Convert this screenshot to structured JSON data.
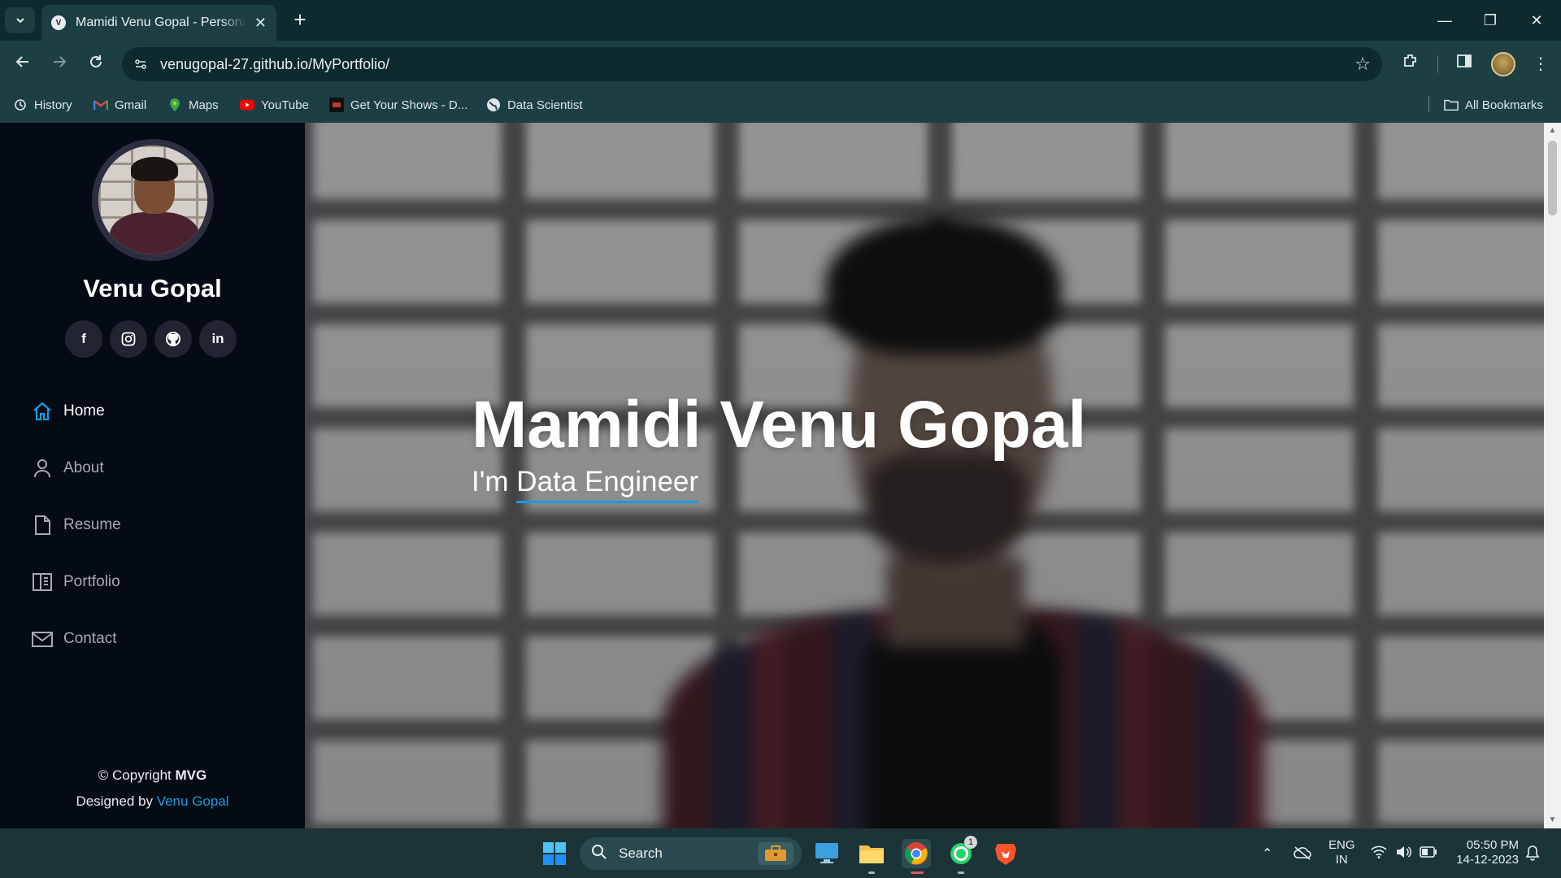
{
  "browser": {
    "tab_title": "Mamidi Venu Gopal - Personal",
    "tab_close": "✕",
    "new_tab": "+",
    "url": "venugopal-27.github.io/MyPortfolio/",
    "window_controls": {
      "minimize": "—",
      "restore": "❐",
      "close": "✕"
    }
  },
  "bookmarks": {
    "items": [
      {
        "label": "History",
        "icon": "history-icon"
      },
      {
        "label": "Gmail",
        "icon": "gmail-icon"
      },
      {
        "label": "Maps",
        "icon": "maps-icon"
      },
      {
        "label": "YouTube",
        "icon": "youtube-icon"
      },
      {
        "label": "Get Your Shows - D...",
        "icon": "shows-icon"
      },
      {
        "label": "Data Scientist",
        "icon": "globe-icon"
      }
    ],
    "all_bookmarks": "All Bookmarks"
  },
  "sidebar": {
    "name": "Venu Gopal",
    "social": [
      {
        "label": "f",
        "icon": "facebook-icon"
      },
      {
        "label": "◎",
        "icon": "instagram-icon"
      },
      {
        "label": "⌥",
        "icon": "github-icon"
      },
      {
        "label": "in",
        "icon": "linkedin-icon"
      }
    ],
    "nav": [
      {
        "label": "Home",
        "icon": "home-icon",
        "active": true
      },
      {
        "label": "About",
        "icon": "person-icon",
        "active": false
      },
      {
        "label": "Resume",
        "icon": "file-icon",
        "active": false
      },
      {
        "label": "Portfolio",
        "icon": "book-icon",
        "active": false
      },
      {
        "label": "Contact",
        "icon": "envelope-icon",
        "active": false
      }
    ],
    "footer": {
      "copyright_prefix": "© Copyright ",
      "copyright_name": "MVG",
      "designed_prefix": "Designed by ",
      "designed_name": "Venu Gopal"
    }
  },
  "hero": {
    "title": "Mamidi Venu Gopal",
    "subtitle_prefix": "I'm ",
    "subtitle_typed": "Data Engineer"
  },
  "taskbar": {
    "search_label": "Search",
    "lang_top": "ENG",
    "lang_bottom": "IN",
    "time": "05:50 PM",
    "date": "14-12-2023",
    "whatsapp_badge": "1"
  },
  "colors": {
    "accent": "#149ddd",
    "sidebar_bg": "#040b14",
    "browser_frame": "#1d3f44"
  }
}
